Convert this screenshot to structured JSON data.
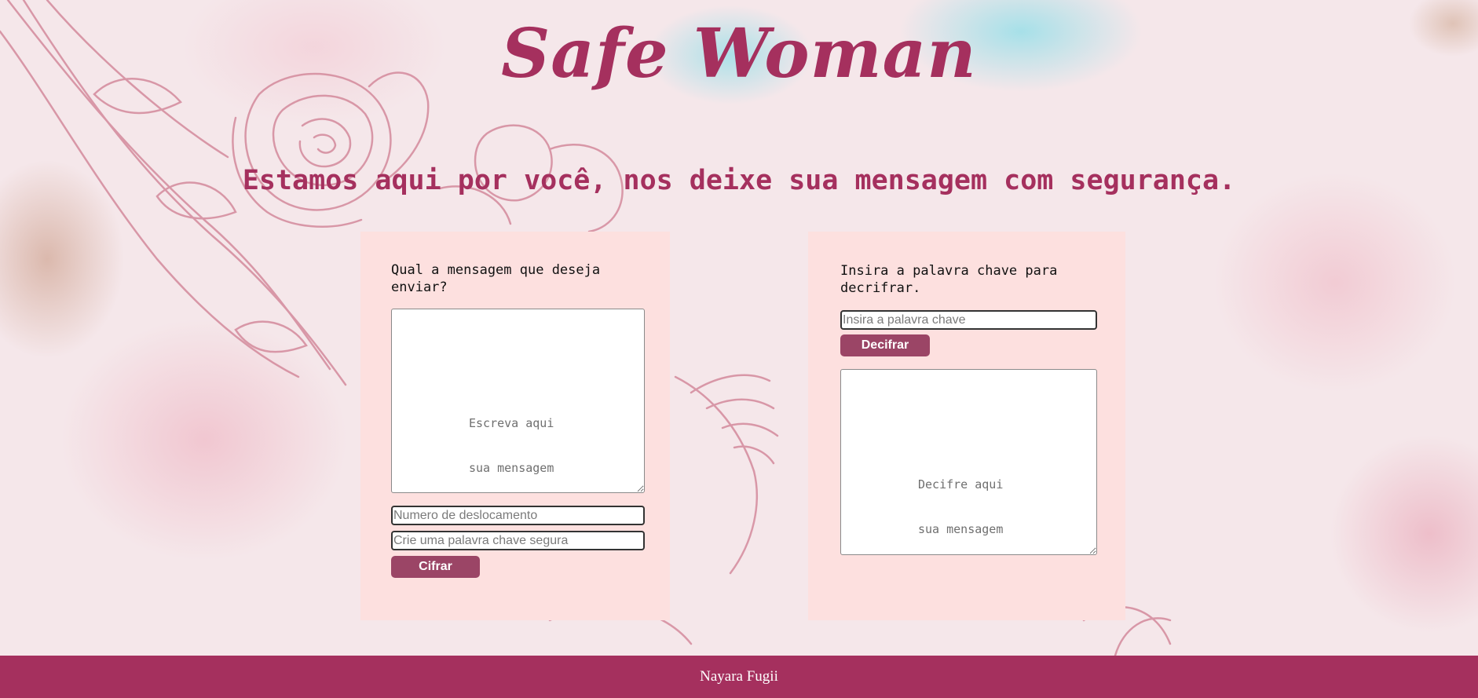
{
  "header": {
    "title": "Safe Woman",
    "tagline": "Estamos aqui por você, nos deixe sua mensagem com segurança."
  },
  "encrypt_card": {
    "prompt_line1": "Qual a mensagem que deseja",
    "prompt_line2": "enviar?",
    "message_placeholder": "Escreva aqui\nsua mensagem",
    "message_placeholder_line1": "Escreva aqui",
    "message_placeholder_line2": "sua mensagem",
    "shift_placeholder": "Numero de deslocamento",
    "keyword_placeholder": "Crie uma palavra chave segura",
    "button_label": "Cifrar"
  },
  "decrypt_card": {
    "prompt_line1": "Insira a palavra chave para",
    "prompt_line2": "decrifrar.",
    "keyword_placeholder": "Insira a palavra chave",
    "button_label": "Decifrar",
    "output_placeholder": "Decifre aqui\nsua mensagem",
    "output_placeholder_line1": "Decifre aqui",
    "output_placeholder_line2": "sua mensagem"
  },
  "footer": {
    "author": "Nayara Fugii"
  },
  "colors": {
    "brand": "#a5305e",
    "button": "#9b4566",
    "card_bg": "#fde0df",
    "floral_lines": "#d48a9c"
  },
  "decorations": {
    "background_art": "floral-line-drawing"
  }
}
